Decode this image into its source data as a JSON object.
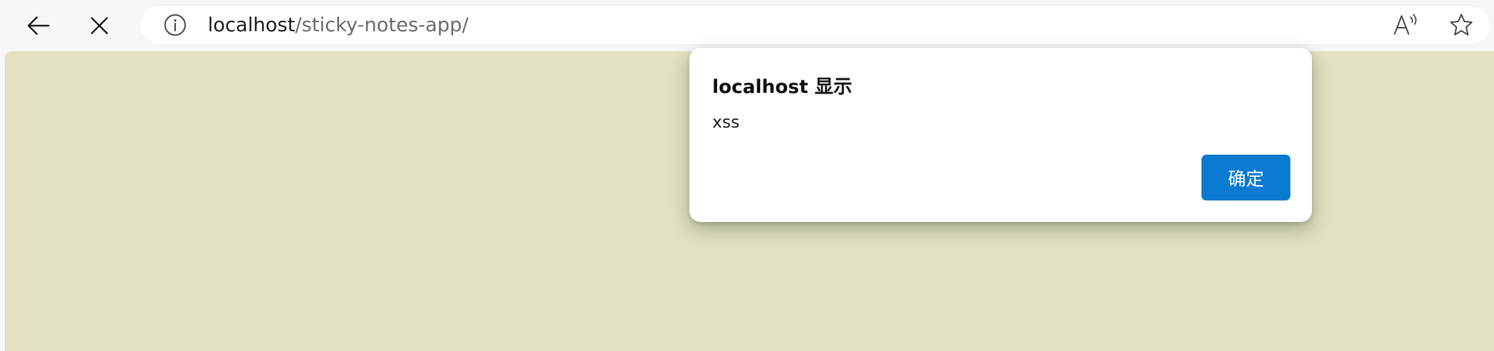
{
  "browser": {
    "url_host": "localhost",
    "url_path": "/sticky-notes-app/",
    "icons": {
      "back": "back-arrow-icon",
      "stop": "close-icon",
      "site_info": "info-icon",
      "read_aloud": "read-aloud-icon",
      "favorite": "star-icon"
    }
  },
  "page": {
    "background_color": "#e2e2c1"
  },
  "dialog": {
    "title": "localhost 显示",
    "message": "xss",
    "ok_label": "确定",
    "accent_color": "#0b7ad1"
  }
}
